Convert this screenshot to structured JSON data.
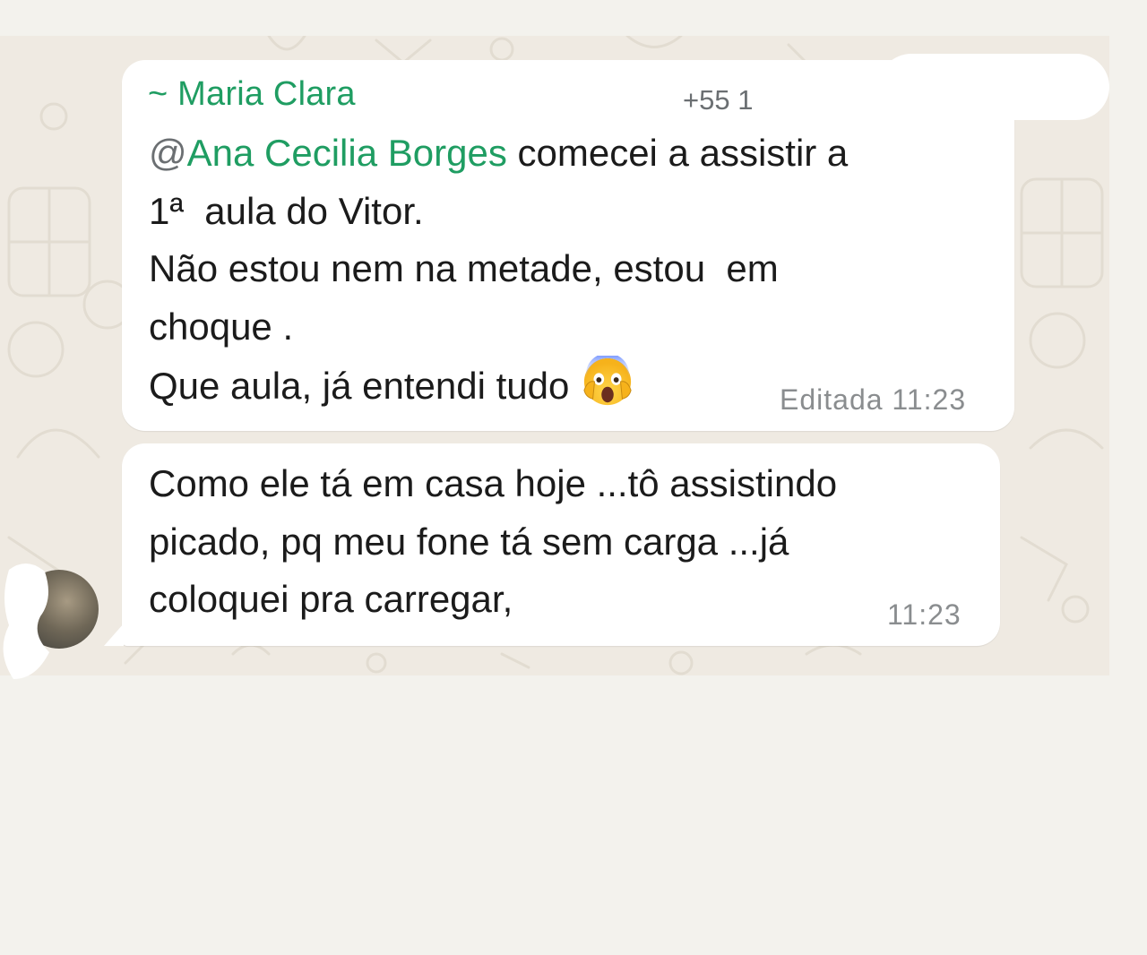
{
  "messages": [
    {
      "sender": "~ Maria Clara",
      "sender_phone": "+55 1",
      "mention_at": "@",
      "mention_name": "Ana Cecilia Borges",
      "line1_rest": " comecei a assistir a",
      "line2": "1ª  aula do Vitor.",
      "line3": "Não estou nem na metade, estou  em",
      "line4": "choque .",
      "line5": "Que aula, já entendi tudo",
      "emoji": "face-screaming-in-fear",
      "meta": "Editada 11:23"
    },
    {
      "line1": "Como ele tá em casa hoje ...tô assistindo",
      "line2": "picado, pq meu fone tá sem carga ...já",
      "line3": "coloquei pra carregar,",
      "meta": "11:23"
    }
  ],
  "colors": {
    "mention": "#1f9d62",
    "bubble": "#ffffff",
    "wallpaper": "#efeae2",
    "meta": "#8a8d8f"
  }
}
